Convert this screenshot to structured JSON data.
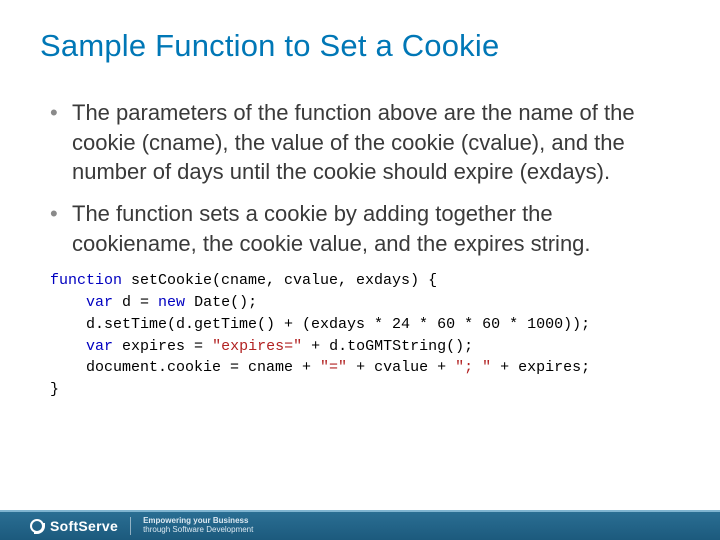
{
  "title": "Sample Function to Set a Cookie",
  "bullets": [
    "The parameters of the function above are the name of the cookie (cname), the value of the cookie (cvalue), and the number of days until the cookie should expire (exdays).",
    "The function sets a cookie by adding together the cookiename, the cookie value, and the expires string."
  ],
  "code": {
    "line1_kw": "function",
    "line1_rest": " setCookie(cname, cvalue, exdays) {",
    "line2_pre": "    ",
    "line2_var": "var",
    "line2_mid": " d = ",
    "line2_new": "new",
    "line2_end": " Date();",
    "line3": "    d.setTime(d.getTime() + (exdays * 24 * 60 * 60 * 1000));",
    "line4_pre": "    ",
    "line4_var": "var",
    "line4_mid": " expires = ",
    "line4_str": "\"expires=\"",
    "line4_end": " + d.toGMTString();",
    "line5_pre": "    document.cookie = cname + ",
    "line5_str1": "\"=\"",
    "line5_mid": " + cvalue + ",
    "line5_str2": "\"; \"",
    "line5_end": " + expires;",
    "line6": "}"
  },
  "footer": {
    "brand": "SoftServe",
    "tagline1": "Empowering your Business",
    "tagline2": "through Software Development"
  }
}
